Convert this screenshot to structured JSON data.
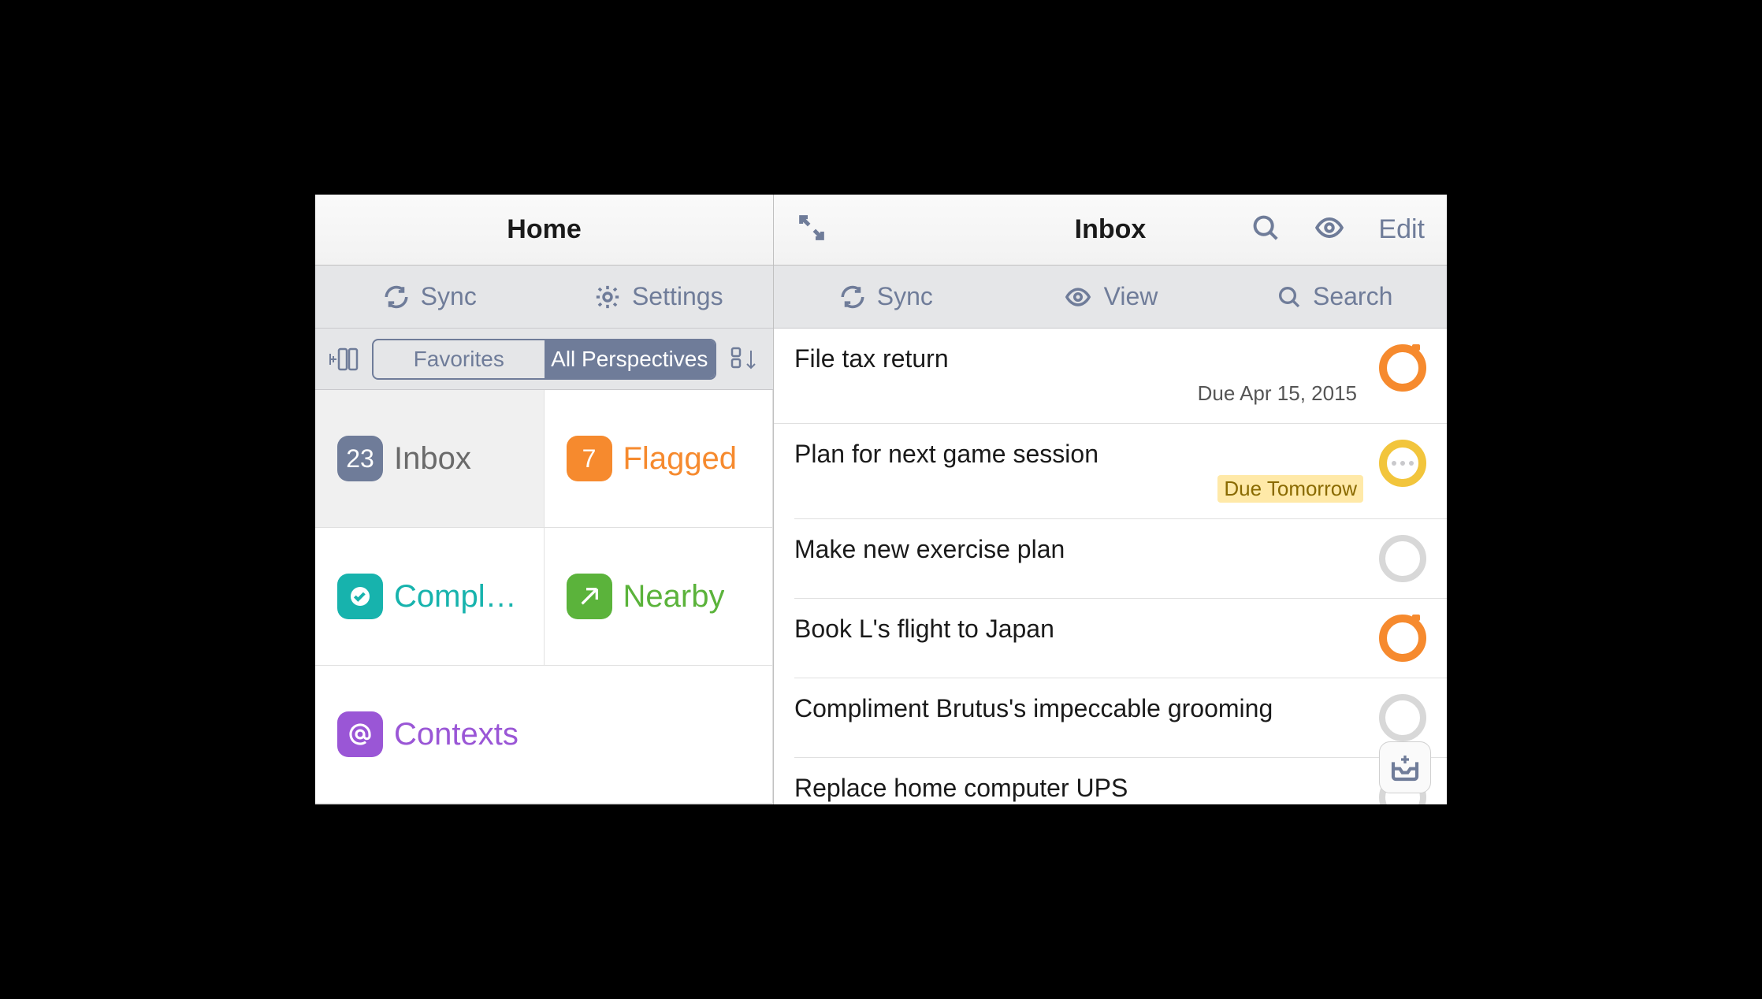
{
  "left": {
    "title": "Home",
    "toolbar": {
      "sync": "Sync",
      "settings": "Settings"
    },
    "segment": {
      "favorites": "Favorites",
      "all": "All Perspectives"
    },
    "tiles": [
      {
        "count": "23",
        "label": "Inbox",
        "labelColor": "#6a6a6a",
        "badgeBg": "#6f7c99",
        "icon": "count",
        "selected": true
      },
      {
        "count": "7",
        "label": "Flagged",
        "labelColor": "#f68a2e",
        "badgeBg": "#f68a2e",
        "icon": "count",
        "selected": false
      },
      {
        "count": "",
        "label": "Compl…",
        "labelColor": "#17b3ad",
        "badgeBg": "#17b3ad",
        "icon": "check",
        "selected": false
      },
      {
        "count": "",
        "label": "Nearby",
        "labelColor": "#5bb33b",
        "badgeBg": "#5bb33b",
        "icon": "arrow",
        "selected": false
      },
      {
        "count": "",
        "label": "Contexts",
        "labelColor": "#9a56d6",
        "badgeBg": "#9a56d6",
        "icon": "at",
        "selected": false,
        "span": 2
      }
    ]
  },
  "right": {
    "title": "Inbox",
    "edit": "Edit",
    "toolbar": {
      "sync": "Sync",
      "view": "View",
      "search": "Search"
    },
    "tasks": [
      {
        "title": "File tax return",
        "due": "Due Apr 15, 2015",
        "dueStyle": "normal",
        "circle": "orange"
      },
      {
        "title": "Plan for next game session",
        "due": "Due Tomorrow",
        "dueStyle": "soon",
        "circle": "yellow"
      },
      {
        "title": "Make new exercise plan",
        "due": "",
        "dueStyle": "",
        "circle": "gray"
      },
      {
        "title": "Book L's flight to Japan",
        "due": "",
        "dueStyle": "",
        "circle": "orange"
      },
      {
        "title": "Compliment Brutus's impeccable grooming",
        "due": "",
        "dueStyle": "",
        "circle": "gray"
      },
      {
        "title": "Replace home computer UPS",
        "due": "",
        "dueStyle": "",
        "circle": "gray"
      }
    ]
  }
}
